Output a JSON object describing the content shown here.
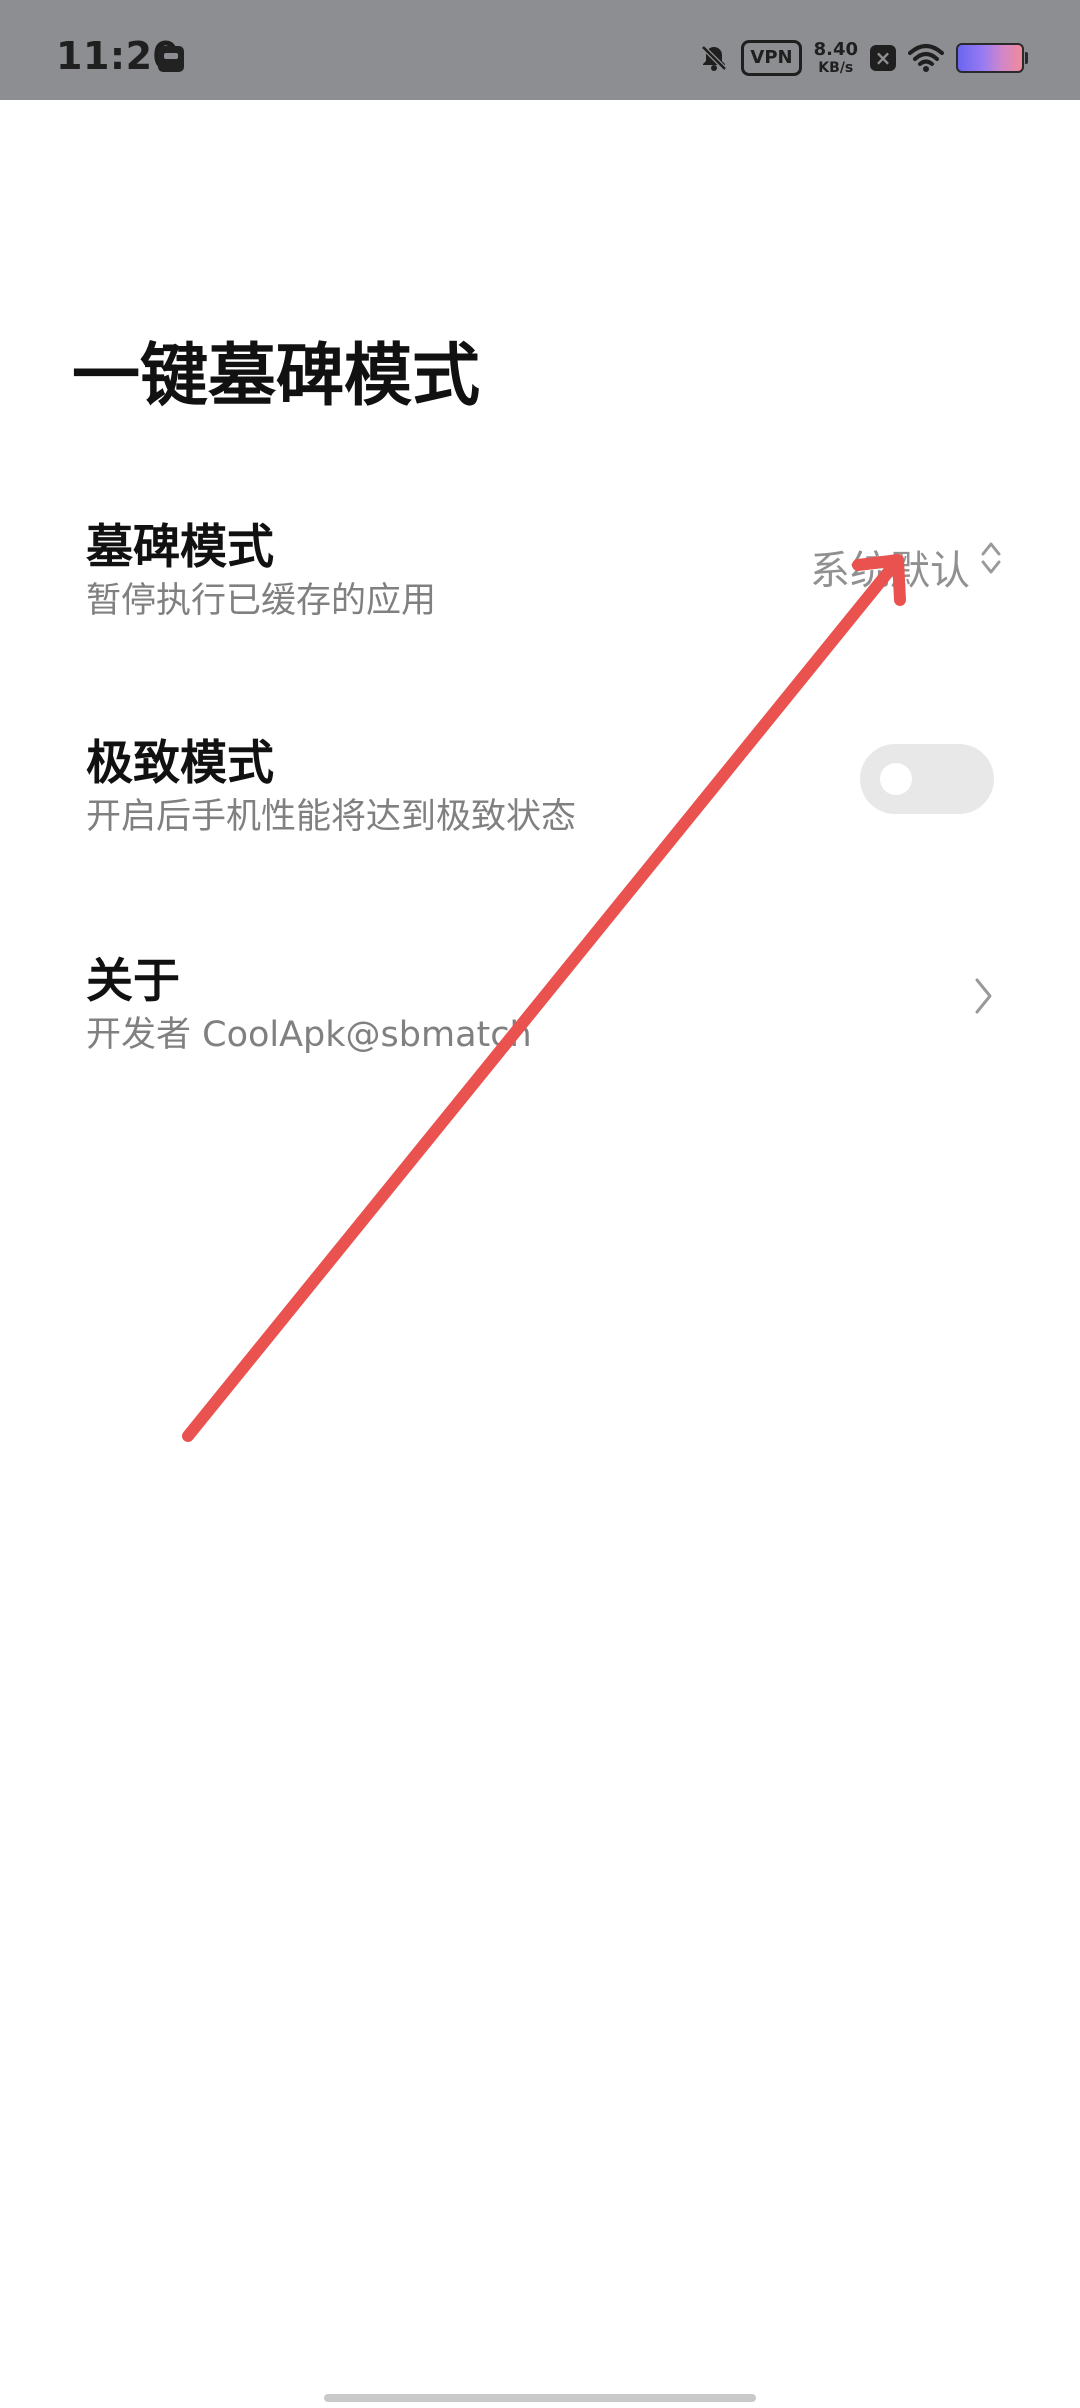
{
  "status_bar": {
    "time": "11:20",
    "vpn": "VPN",
    "speed_value": "8.40",
    "speed_unit": "KB/s",
    "icons": [
      "notification-off-icon",
      "vpn-icon",
      "network-speed",
      "sim-blocked-icon",
      "wifi-icon",
      "battery-icon"
    ]
  },
  "page": {
    "title": "一键墓碑模式"
  },
  "settings": {
    "mode": {
      "title": "墓碑模式",
      "subtitle": "暂停执行已缓存的应用",
      "value": "系统默认"
    },
    "extreme": {
      "title": "极致模式",
      "subtitle": "开启后手机性能将达到极致状态",
      "enabled": false
    },
    "about": {
      "title": "关于",
      "subtitle": "开发者 CoolApk@sbmatch"
    }
  },
  "colors": {
    "status_bar_bg": "#8d8e91",
    "annotation_arrow": "#e9524f",
    "toggle_off": "#e8e8e8"
  }
}
